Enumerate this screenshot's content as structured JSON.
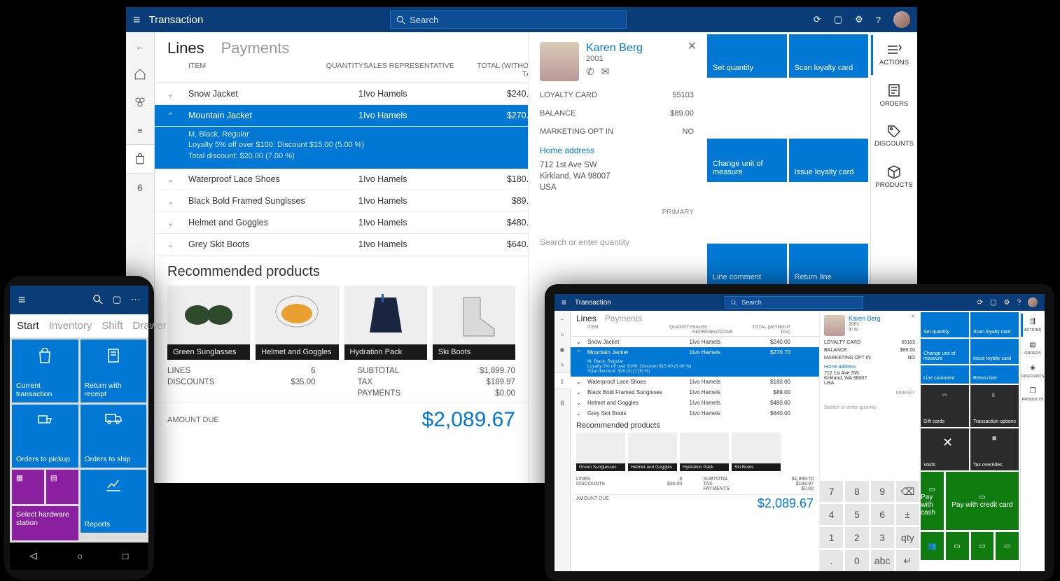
{
  "header": {
    "title": "Transaction",
    "searchPlaceholder": "Search"
  },
  "leftrail": {
    "count": "6"
  },
  "tabs": {
    "lines": "Lines",
    "payments": "Payments"
  },
  "columns": {
    "item": "ITEM",
    "qty": "QUANTITY",
    "rep": "SALES REPRESENTATIVE",
    "tot": "TOTAL (WITHOUT TAX)"
  },
  "lines": [
    {
      "item": "Snow Jacket",
      "qty": "1",
      "rep": "Ivo Hamels",
      "tot": "$240.00"
    },
    {
      "item": "Mountain Jacket",
      "qty": "1",
      "rep": "Ivo Hamels",
      "tot": "$270.70"
    },
    {
      "item": "Waterproof Lace Shoes",
      "qty": "1",
      "rep": "Ivo Hamels",
      "tot": "$180.00"
    },
    {
      "item": "Black Bold Framed Sunglsses",
      "qty": "1",
      "rep": "Ivo Hamels",
      "tot": "$89.00"
    },
    {
      "item": "Helmet and Goggles",
      "qty": "1",
      "rep": "Ivo Hamels",
      "tot": "$480.00"
    },
    {
      "item": "Grey Skit Boots",
      "qty": "1",
      "rep": "Ivo Hamels",
      "tot": "$640.00"
    }
  ],
  "selectedDetails": {
    "l1": "M, Black, Regular",
    "l2": "Loyalty 5% off over $100: Discount $15.00 (5.00 %)",
    "l3": "Total discount: $20.00 (7.00 %)"
  },
  "recommended": {
    "title": "Recommended products",
    "items": [
      "Green Sunglasses",
      "Helmet and Goggles",
      "Hydration Pack",
      "Ski Boots"
    ]
  },
  "totals": {
    "linesLabel": "LINES",
    "lines": "6",
    "discountsLabel": "DISCOUNTS",
    "discounts": "$35.00",
    "subtotalLabel": "SUBTOTAL",
    "subtotal": "$1,899.70",
    "taxLabel": "TAX",
    "tax": "$189.97",
    "paymentsLabel": "PAYMENTS",
    "payments": "$0.00",
    "amountDueLabel": "AMOUNT DUE",
    "amountDue": "$2,089.67"
  },
  "customer": {
    "name": "Karen Berg",
    "year": "2001",
    "loyaltyLabel": "LOYALTY CARD",
    "loyalty": "55103",
    "balanceLabel": "BALANCE",
    "balance": "$89.00",
    "optinLabel": "MARKETING OPT IN",
    "optin": "NO",
    "homeAddressLabel": "Home address",
    "addr1": "712 1st Ave SW",
    "addr2": "Kirkland, WA 98007",
    "addr3": "USA",
    "primary": "PRIMARY",
    "searchPrompt": "Search or enter quantity"
  },
  "tiles": {
    "setQty": "Set quantity",
    "scanLoyalty": "Scan loyalty card",
    "changeUom": "Change unit of measure",
    "issueLoyalty": "Issue loyalty card",
    "lineComment": "Line comment",
    "returnLine": "Return line",
    "giftCards": "Gift cards",
    "txOptions": "Transaction options",
    "voids": "Voids",
    "taxOverrides": "Tax overrides",
    "payCash": "Pay with cash",
    "payCredit": "Pay with credit card"
  },
  "rightrail": {
    "actions": "ACTIONS",
    "orders": "ORDERS",
    "discounts": "DISCOUNTS",
    "products": "PRODUCTS"
  },
  "phone": {
    "tabs": [
      "Start",
      "Inventory",
      "Shift",
      "Drawer"
    ],
    "tiles": {
      "current": "Current transaction",
      "returnReceipt": "Return with receipt",
      "ordersPickup": "Orders to pickup",
      "ordersShip": "Orders to ship",
      "hwStation": "Select hardware station",
      "reports": "Reports"
    }
  },
  "keypad": {
    "keys": [
      "7",
      "8",
      "9",
      "⌫",
      "4",
      "5",
      "6",
      "±",
      "1",
      "2",
      "3",
      "qty",
      ".",
      "0",
      "abc",
      "↵"
    ]
  }
}
